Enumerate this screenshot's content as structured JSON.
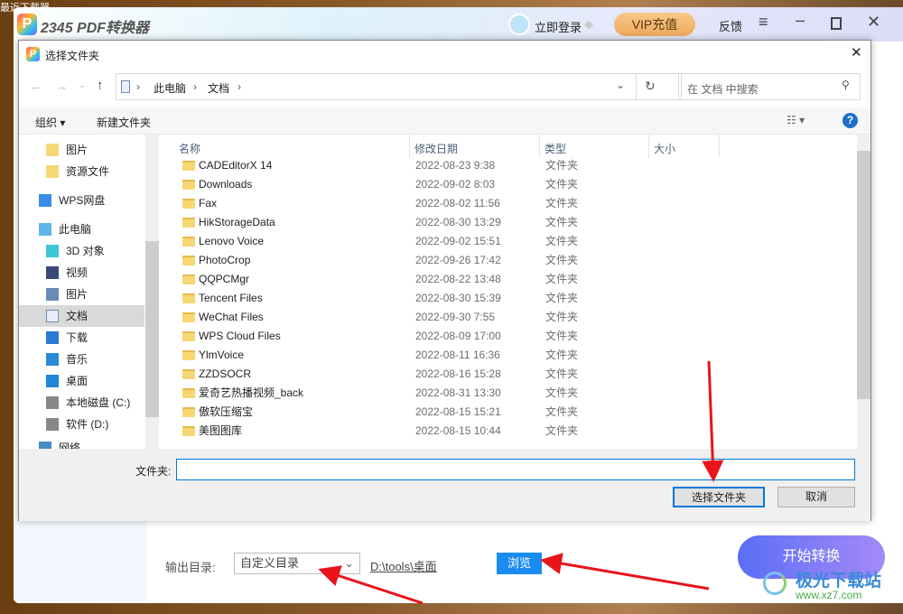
{
  "app": {
    "title": "2345 PDF转换器",
    "login": "立即登录",
    "vip": "VIP充值",
    "feedback": "反馈",
    "output_label": "输出目录:",
    "output_select": "自定义目录",
    "output_path": "D:\\tools\\桌面",
    "browse": "浏览",
    "start": "开始转换"
  },
  "desktop": {
    "top_text": "最近下载器"
  },
  "watermark": {
    "name": "极光下载站",
    "url": "www.xz7.com"
  },
  "dialog": {
    "title": "选择文件夹",
    "breadcrumb": [
      "此电脑",
      "文档"
    ],
    "search_placeholder": "在 文档 中搜索",
    "toolbar": {
      "organize": "组织",
      "new_folder": "新建文件夹"
    },
    "nav": [
      {
        "label": "图片",
        "icon": "folder-icon"
      },
      {
        "label": "资源文件",
        "icon": "folder-icon"
      },
      {
        "label": "WPS网盘",
        "icon": "cloud-icon"
      },
      {
        "label": "此电脑",
        "icon": "computer-icon"
      },
      {
        "label": "3D 对象",
        "icon": "cube-icon"
      },
      {
        "label": "视频",
        "icon": "video-icon"
      },
      {
        "label": "图片",
        "icon": "picture-icon"
      },
      {
        "label": "文档",
        "icon": "document-icon",
        "selected": true
      },
      {
        "label": "下载",
        "icon": "download-icon"
      },
      {
        "label": "音乐",
        "icon": "music-icon"
      },
      {
        "label": "桌面",
        "icon": "desktop-icon"
      },
      {
        "label": "本地磁盘 (C:)",
        "icon": "drive-icon"
      },
      {
        "label": "软件 (D:)",
        "icon": "drive-icon"
      },
      {
        "label": "网络",
        "icon": "network-icon"
      }
    ],
    "columns": [
      "名称",
      "修改日期",
      "类型",
      "大小"
    ],
    "files": [
      {
        "name": "CADEditorX 14",
        "date": "2022-08-23 9:38",
        "type": "文件夹"
      },
      {
        "name": "Downloads",
        "date": "2022-09-02 8:03",
        "type": "文件夹"
      },
      {
        "name": "Fax",
        "date": "2022-08-02 11:56",
        "type": "文件夹"
      },
      {
        "name": "HikStorageData",
        "date": "2022-08-30 13:29",
        "type": "文件夹"
      },
      {
        "name": "Lenovo Voice",
        "date": "2022-09-02 15:51",
        "type": "文件夹"
      },
      {
        "name": "PhotoCrop",
        "date": "2022-09-26 17:42",
        "type": "文件夹"
      },
      {
        "name": "QQPCMgr",
        "date": "2022-08-22 13:48",
        "type": "文件夹"
      },
      {
        "name": "Tencent Files",
        "date": "2022-08-30 15:39",
        "type": "文件夹"
      },
      {
        "name": "WeChat Files",
        "date": "2022-09-30 7:55",
        "type": "文件夹"
      },
      {
        "name": "WPS Cloud Files",
        "date": "2022-08-09 17:00",
        "type": "文件夹"
      },
      {
        "name": "YlmVoice",
        "date": "2022-08-11 16:36",
        "type": "文件夹"
      },
      {
        "name": "ZZDSOCR",
        "date": "2022-08-16 15:28",
        "type": "文件夹"
      },
      {
        "name": "爱奇艺热播视频_back",
        "date": "2022-08-31 13:30",
        "type": "文件夹"
      },
      {
        "name": "傲软压缩宝",
        "date": "2022-08-15 15:21",
        "type": "文件夹"
      },
      {
        "name": "美图图库",
        "date": "2022-08-15 10:44",
        "type": "文件夹"
      }
    ],
    "folder_label": "文件夹:",
    "folder_value": "",
    "select_button": "选择文件夹",
    "cancel_button": "取消"
  },
  "colors": {
    "accent": "#0078d7",
    "browse": "#1a8cf0",
    "vip": "#f4b46a",
    "arrow": "#e8141a"
  }
}
